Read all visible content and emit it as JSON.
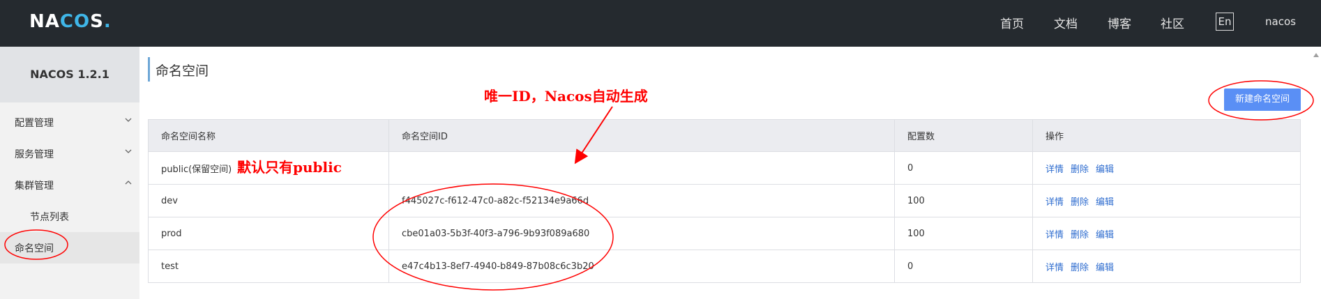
{
  "header": {
    "logo_main_1": "NA",
    "logo_main_2": "CO",
    "logo_main_3": "S",
    "logo_dot": ".",
    "nav": [
      {
        "label": "首页"
      },
      {
        "label": "文档"
      },
      {
        "label": "博客"
      },
      {
        "label": "社区"
      }
    ],
    "lang_label": "En",
    "user": "nacos"
  },
  "sidebar": {
    "title": "NACOS 1.2.1",
    "items": [
      {
        "label": "配置管理",
        "icon": "chevron-down-icon"
      },
      {
        "label": "服务管理",
        "icon": "chevron-down-icon"
      },
      {
        "label": "集群管理",
        "icon": "chevron-up-icon"
      },
      {
        "label": "节点列表"
      },
      {
        "label": "命名空间"
      }
    ]
  },
  "main": {
    "title": "命名空间",
    "new_button": "新建命名空间",
    "table": {
      "headers": [
        "命名空间名称",
        "命名空间ID",
        "配置数",
        "操作"
      ],
      "rows": [
        {
          "name": "public(保留空间)",
          "id": "",
          "count": "0"
        },
        {
          "name": "dev",
          "id": "f445027c-f612-47c0-a82c-f52134e9a66d",
          "count": "100"
        },
        {
          "name": "prod",
          "id": "cbe01a03-5b3f-40f3-a796-9b93f089a680",
          "count": "100"
        },
        {
          "name": "test",
          "id": "e47c4b13-8ef7-4940-b849-87b08c6c3b20",
          "count": "0"
        }
      ],
      "actions": [
        "详情",
        "删除",
        "编辑"
      ]
    }
  },
  "annotations": {
    "id_note": "唯一ID，Nacos自动生成",
    "public_note": "默认只有public",
    "color": "#ff0000"
  },
  "colors": {
    "topbar": "#252a2f",
    "accent": "#5a8ff5",
    "link": "#2e6ccf"
  }
}
